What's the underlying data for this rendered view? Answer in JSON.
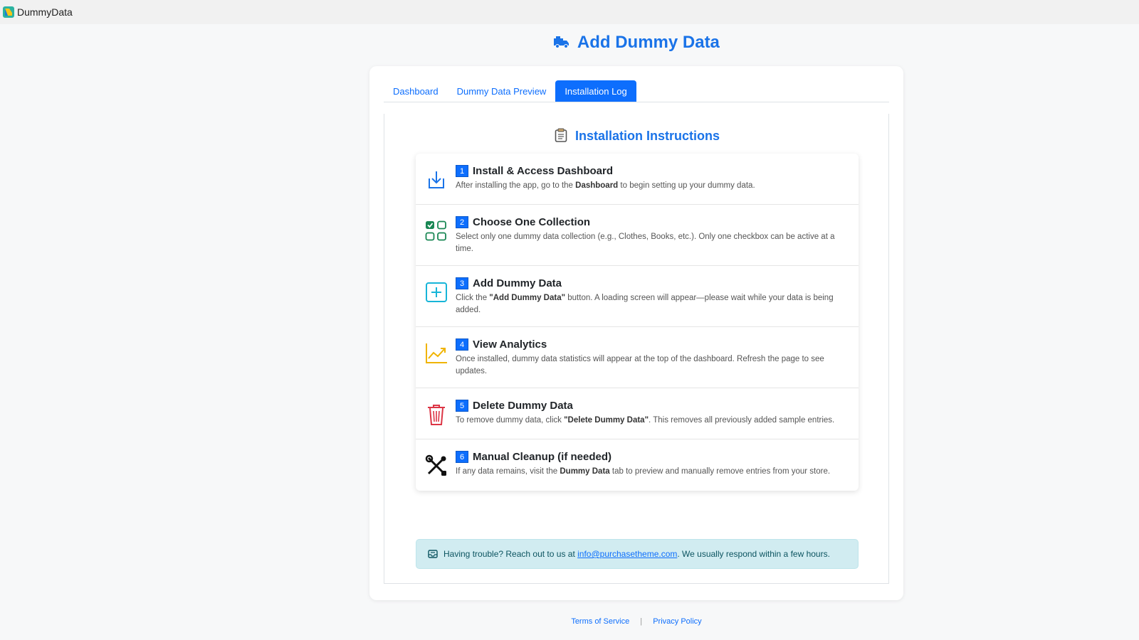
{
  "app": {
    "name": "DummyData"
  },
  "page": {
    "title": "Add Dummy Data"
  },
  "tabs": [
    {
      "label": "Dashboard",
      "active": false
    },
    {
      "label": "Dummy Data Preview",
      "active": false
    },
    {
      "label": "Installation Log",
      "active": true
    }
  ],
  "instructions": {
    "title": "Installation Instructions",
    "steps": [
      {
        "number": "1",
        "title": "Install & Access Dashboard",
        "icon": "download-icon",
        "desc_before": "After installing the app, go to the ",
        "desc_bold": "Dashboard",
        "desc_after": " to begin setting up your dummy data."
      },
      {
        "number": "2",
        "title": "Choose One Collection",
        "icon": "checkbox-grid-icon",
        "desc_before": "Select only one dummy data collection (e.g., Clothes, Books, etc.). Only one checkbox can be active at a time.",
        "desc_bold": "",
        "desc_after": ""
      },
      {
        "number": "3",
        "title": "Add Dummy Data",
        "icon": "plus-square-icon",
        "desc_before": "Click the ",
        "desc_bold": "\"Add Dummy Data\"",
        "desc_after": " button. A loading screen will appear—please wait while your data is being added."
      },
      {
        "number": "4",
        "title": "View Analytics",
        "icon": "chart-line-icon",
        "desc_before": "Once installed, dummy data statistics will appear at the top of the dashboard. Refresh the page to see updates.",
        "desc_bold": "",
        "desc_after": ""
      },
      {
        "number": "5",
        "title": "Delete Dummy Data",
        "icon": "trash-icon",
        "desc_before": "To remove dummy data, click ",
        "desc_bold": "\"Delete Dummy Data\"",
        "desc_after": ". This removes all previously added sample entries."
      },
      {
        "number": "6",
        "title": "Manual Cleanup (if needed)",
        "icon": "tools-icon",
        "desc_before": "If any data remains, visit the ",
        "desc_bold": "Dummy Data",
        "desc_after": " tab to preview and manually remove entries from your store."
      }
    ]
  },
  "support": {
    "text_before": "Having trouble? Reach out to us at ",
    "email": "info@purchasetheme.com",
    "text_after": ". We usually respond within a few hours."
  },
  "footer": {
    "terms": "Terms of Service",
    "separator": "|",
    "privacy": "Privacy Policy"
  },
  "colors": {
    "accent": "#1a73e8",
    "tab_active": "#0d6efd",
    "alert_bg": "#d1ecf1"
  }
}
